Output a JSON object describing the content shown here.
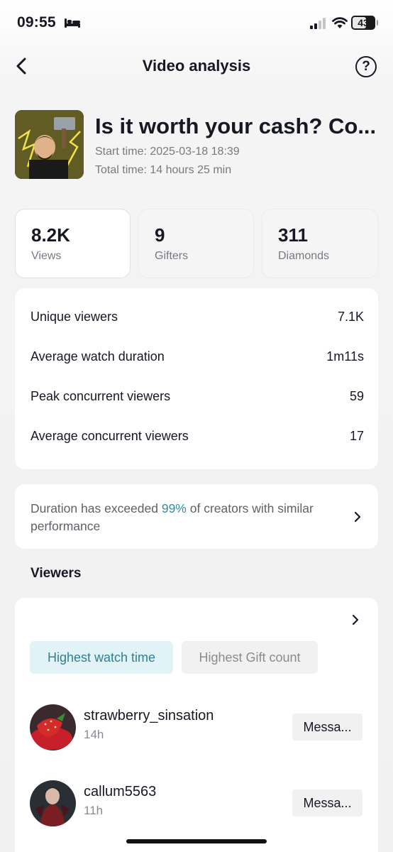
{
  "status_bar": {
    "time": "09:55",
    "battery": "43"
  },
  "nav": {
    "title": "Video analysis",
    "help": "?"
  },
  "video": {
    "title": "Is it worth your cash? Co...",
    "start_time": "Start time: 2025-03-18 18:39",
    "total_time": "Total time: 14 hours 25 min"
  },
  "stats": [
    {
      "value": "8.2K",
      "label": "Views",
      "active": true
    },
    {
      "value": "9",
      "label": "Gifters",
      "active": false
    },
    {
      "value": "311",
      "label": "Diamonds",
      "active": false
    }
  ],
  "metrics": [
    {
      "label": "Unique viewers",
      "value": "7.1K"
    },
    {
      "label": "Average watch duration",
      "value": "1m11s"
    },
    {
      "label": "Peak concurrent viewers",
      "value": "59"
    },
    {
      "label": "Average concurrent viewers",
      "value": "17"
    }
  ],
  "duration_card": {
    "prefix": "Duration has exceeded ",
    "highlight": "99%",
    "suffix": " of creators with similar performance"
  },
  "viewers": {
    "section_title": "Viewers",
    "tabs": [
      {
        "label": "Highest watch time",
        "active": true
      },
      {
        "label": "Highest Gift count",
        "active": false
      }
    ],
    "list": [
      {
        "username": "strawberry_sinsation",
        "time": "14h",
        "button": "Messa..."
      },
      {
        "username": "callum5563",
        "time": "11h",
        "button": "Messa..."
      }
    ]
  },
  "colors": {
    "accent": "#2f8aa0",
    "tab_active_bg": "#e2f3f7",
    "text": "#161823",
    "muted": "#777a80"
  },
  "icons": [
    "bed-icon",
    "signal-icon",
    "wifi-icon",
    "battery-icon",
    "back-chevron-icon",
    "help-icon",
    "chevron-right-icon"
  ]
}
